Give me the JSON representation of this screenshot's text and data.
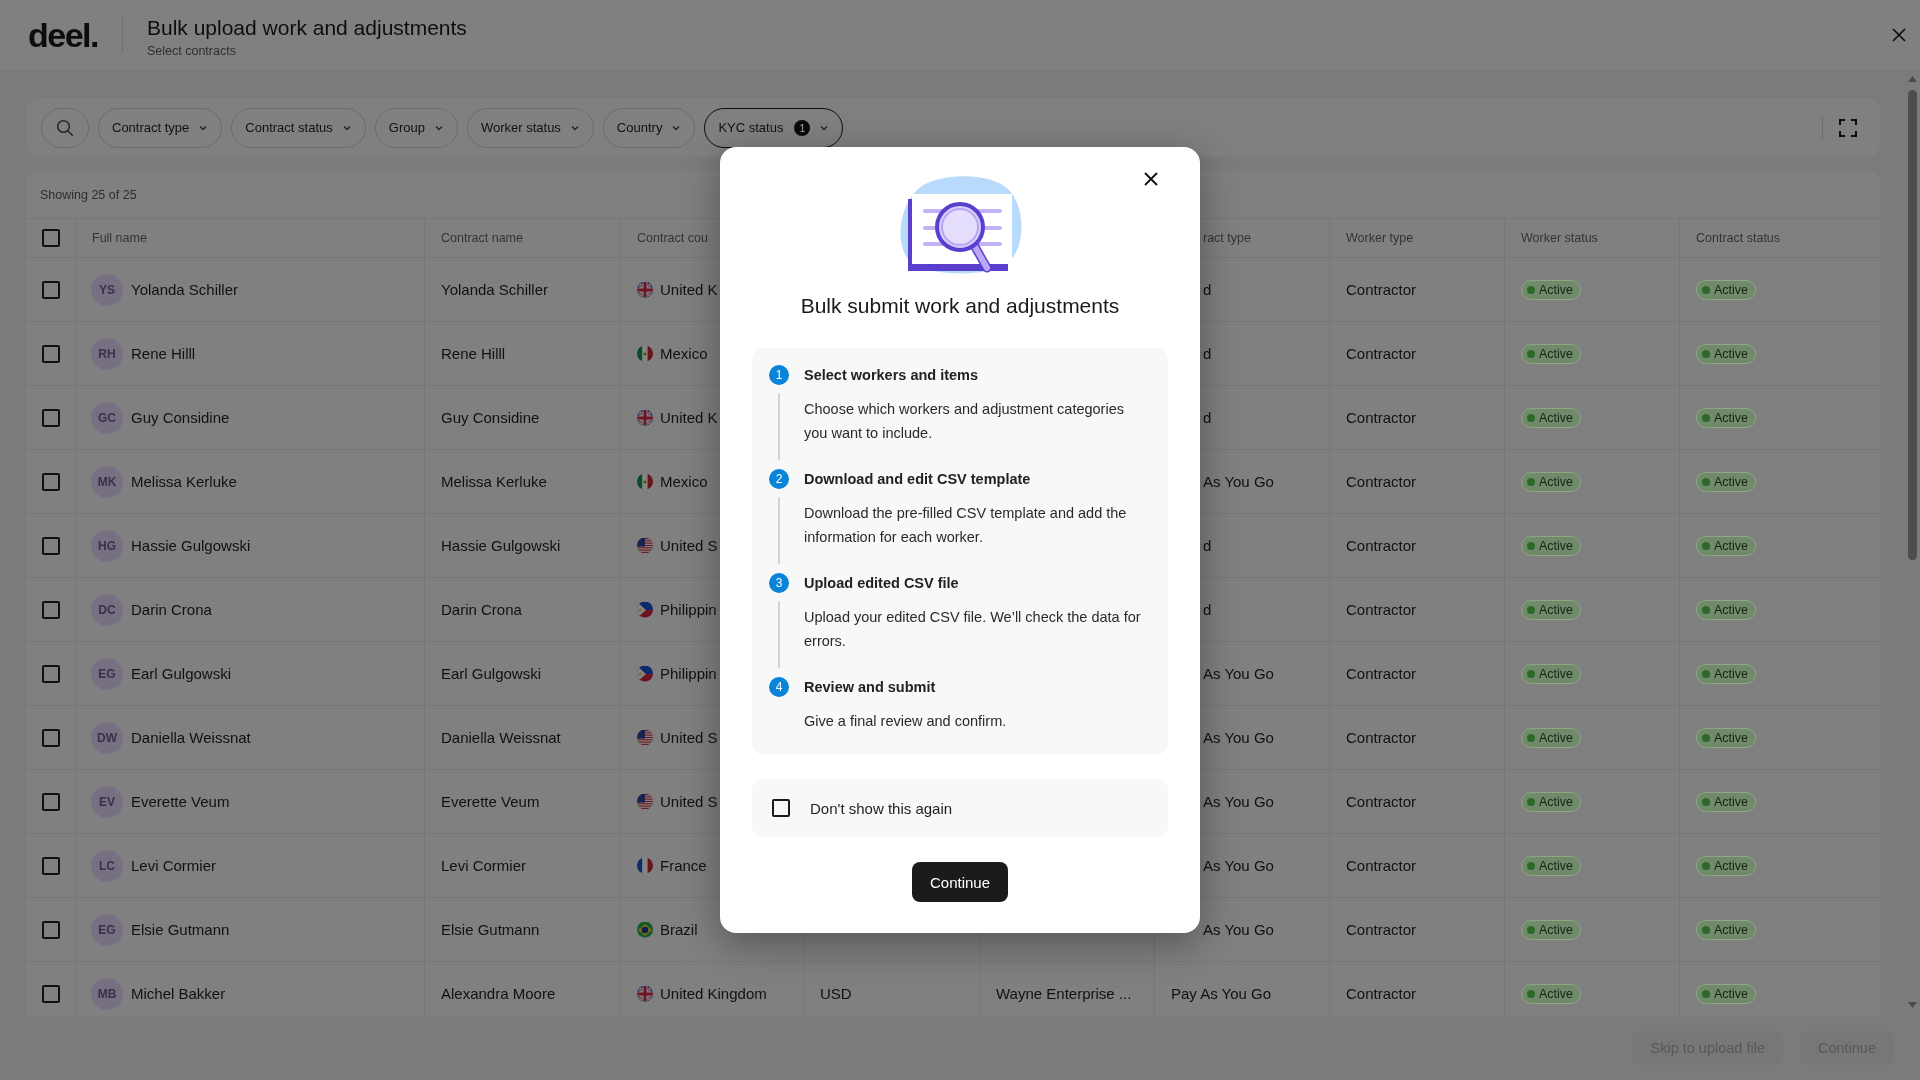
{
  "top_bar": {
    "logo": "deel.",
    "title": "Bulk upload work and adjustments",
    "subtitle": "Select contracts"
  },
  "filters": [
    {
      "label": "Contract type",
      "active": false
    },
    {
      "label": "Contract status",
      "active": false
    },
    {
      "label": "Group",
      "active": false
    },
    {
      "label": "Worker status",
      "active": false
    },
    {
      "label": "Country",
      "active": false
    },
    {
      "label": "KYC status",
      "active": true,
      "count": "1"
    }
  ],
  "table": {
    "summary": "Showing 25 of 25",
    "select_all": {
      "checked": false
    },
    "header": {
      "full_name": "Full name",
      "contract_name": "Contract name",
      "column_3": "Contract cou",
      "column_6": "ract type",
      "worker_type": "Worker type",
      "worker_status": "Worker status",
      "contract_status": "Contract status"
    },
    "rows": [
      {
        "checked": false,
        "initials": "YS",
        "full_name": "Yolanda Schiller",
        "contract_name": "Yolanda Schiller",
        "column_3": {
          "text": "United K",
          "kind": "gb"
        },
        "column_6": "d",
        "worker_type": "Contractor",
        "worker_status": "Active",
        "contract_status": "Active"
      },
      {
        "checked": false,
        "initials": "RH",
        "full_name": "Rene Hilll",
        "contract_name": "Rene Hilll",
        "column_3": {
          "text": "Mexico",
          "kind": "mx"
        },
        "column_6": "d",
        "worker_type": "Contractor",
        "worker_status": "Active",
        "contract_status": "Active"
      },
      {
        "checked": false,
        "initials": "GC",
        "full_name": "Guy Considine",
        "contract_name": "Guy Considine",
        "column_3": {
          "text": "United K",
          "kind": "gb"
        },
        "column_6": "d",
        "worker_type": "Contractor",
        "worker_status": "Active",
        "contract_status": "Active"
      },
      {
        "checked": false,
        "initials": "MK",
        "full_name": "Melissa Kerluke",
        "contract_name": "Melissa Kerluke",
        "column_3": {
          "text": "Mexico",
          "kind": "mx"
        },
        "column_6": "As You Go",
        "worker_type": "Contractor",
        "worker_status": "Active",
        "contract_status": "Active"
      },
      {
        "checked": false,
        "initials": "HG",
        "full_name": "Hassie Gulgowski",
        "contract_name": "Hassie Gulgowski",
        "column_3": {
          "text": "United S",
          "kind": "us"
        },
        "column_6": "d",
        "worker_type": "Contractor",
        "worker_status": "Active",
        "contract_status": "Active"
      },
      {
        "checked": false,
        "initials": "DC",
        "full_name": "Darin Crona",
        "contract_name": "Darin Crona",
        "column_3": {
          "text": "Philippin",
          "kind": "ph"
        },
        "column_6": "d",
        "worker_type": "Contractor",
        "worker_status": "Active",
        "contract_status": "Active"
      },
      {
        "checked": false,
        "initials": "EG",
        "full_name": "Earl Gulgowski",
        "contract_name": "Earl Gulgowski",
        "column_3": {
          "text": "Philippin",
          "kind": "ph"
        },
        "column_6": "As You Go",
        "worker_type": "Contractor",
        "worker_status": "Active",
        "contract_status": "Active"
      },
      {
        "checked": false,
        "initials": "DW",
        "full_name": "Daniella Weissnat",
        "contract_name": "Daniella Weissnat",
        "column_3": {
          "text": "United S",
          "kind": "us"
        },
        "column_6": "As You Go",
        "worker_type": "Contractor",
        "worker_status": "Active",
        "contract_status": "Active"
      },
      {
        "checked": false,
        "initials": "EV",
        "full_name": "Everette Veum",
        "contract_name": "Everette Veum",
        "column_3": {
          "text": "United S",
          "kind": "us"
        },
        "column_6": "As You Go",
        "worker_type": "Contractor",
        "worker_status": "Active",
        "contract_status": "Active"
      },
      {
        "checked": false,
        "initials": "LC",
        "full_name": "Levi Cormier",
        "contract_name": "Levi Cormier",
        "column_3": {
          "text": "France",
          "kind": "fr"
        },
        "column_6": "As You Go",
        "worker_type": "Contractor",
        "worker_status": "Active",
        "contract_status": "Active"
      },
      {
        "checked": false,
        "initials": "EG",
        "full_name": "Elsie Gutmann",
        "contract_name": "Elsie Gutmann",
        "column_3": {
          "text": "Brazil",
          "kind": "br"
        },
        "column_6": "As You Go",
        "worker_type": "Contractor",
        "worker_status": "Active",
        "contract_status": "Active"
      },
      {
        "checked": false,
        "initials": "MB",
        "full_name": "Michel Bakker",
        "contract_name": "Alexandra Moore",
        "column_3": {
          "text": "United Kingdom",
          "kind": "gb"
        },
        "column_4": "USD",
        "column_5": "Wayne Enterprise ...",
        "column_6": "Pay As You Go",
        "worker_type": "Contractor",
        "worker_status": "Active",
        "contract_status": "Active"
      }
    ]
  },
  "footer": {
    "buttons": [
      {
        "label": "Skip to upload file",
        "disabled": true
      },
      {
        "label": "Continue",
        "disabled": true
      }
    ]
  },
  "modal": {
    "title": "Bulk submit work and adjustments",
    "steps": [
      {
        "number": "1",
        "title": "Select workers and items",
        "description": "Choose which workers and adjustment categories you want to include."
      },
      {
        "number": "2",
        "title": "Download and edit CSV template",
        "description": "Download the pre-filled CSV template and add the information for each worker."
      },
      {
        "number": "3",
        "title": "Upload edited CSV file",
        "description": "Upload your edited CSV file. We’ll check the data for errors."
      },
      {
        "number": "4",
        "title": "Review and submit",
        "description": "Give a final review and confirm."
      }
    ],
    "dont_show_again": {
      "label": "Don't show this again",
      "checked": false
    },
    "button": "Continue"
  }
}
